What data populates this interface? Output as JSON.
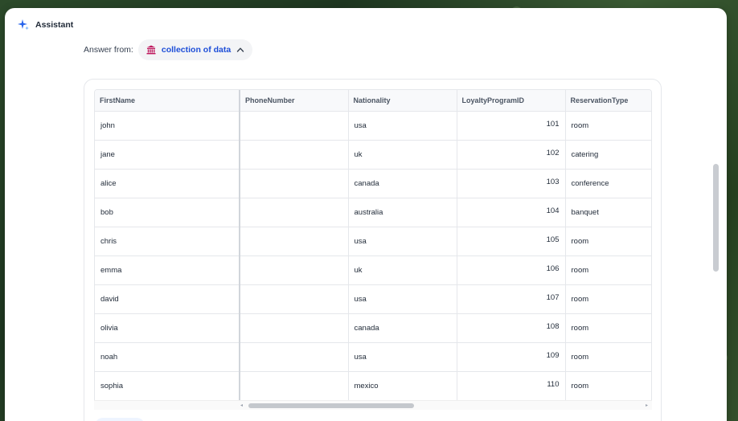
{
  "header": {
    "title": "Assistant",
    "icon": "sparkle-icon"
  },
  "answer_from": {
    "label": "Answer from:",
    "source": "collection of data",
    "source_icon": "bank-icon",
    "accent_color": "#1d4ed8",
    "icon_color": "#be185d"
  },
  "table": {
    "columns": [
      "FirstName",
      "PhoneNumber",
      "Nationality",
      "LoyaltyProgramID",
      "ReservationType"
    ],
    "rows": [
      [
        "john",
        "",
        "usa",
        "101",
        "room"
      ],
      [
        "jane",
        "",
        "uk",
        "102",
        "catering"
      ],
      [
        "alice",
        "",
        "canada",
        "103",
        "conference"
      ],
      [
        "bob",
        "",
        "australia",
        "104",
        "banquet"
      ],
      [
        "chris",
        "",
        "usa",
        "105",
        "room"
      ],
      [
        "emma",
        "",
        "uk",
        "106",
        "room"
      ],
      [
        "david",
        "",
        "usa",
        "107",
        "room"
      ],
      [
        "olivia",
        "",
        "canada",
        "108",
        "room"
      ],
      [
        "noah",
        "",
        "usa",
        "109",
        "room"
      ],
      [
        "sophia",
        "",
        "mexico",
        "110",
        "room"
      ]
    ]
  }
}
